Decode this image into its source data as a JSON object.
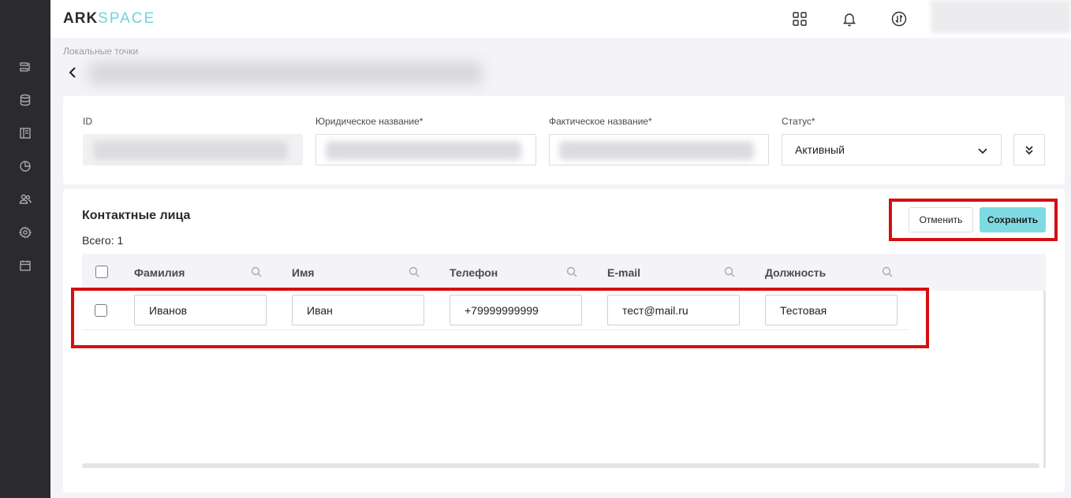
{
  "logo": {
    "part1": "ARK",
    "part2": "SPACE"
  },
  "sidebar": {
    "items": [
      {
        "name": "list-icon"
      },
      {
        "name": "database-icon"
      },
      {
        "name": "layout-icon"
      },
      {
        "name": "pie-chart-icon"
      },
      {
        "name": "users-icon"
      },
      {
        "name": "settings-icon"
      },
      {
        "name": "calendar-icon"
      }
    ]
  },
  "topbar": {
    "icons": [
      "grid-icon",
      "bell-icon",
      "sync-icon"
    ]
  },
  "breadcrumb": "Локальные точки",
  "form": {
    "id_label": "ID",
    "legal_name_label": "Юридическое название*",
    "actual_name_label": "Фактическое название*",
    "status_label": "Статус*",
    "status_value": "Активный"
  },
  "contacts": {
    "title": "Контактные лица",
    "total": "Всего: 1",
    "cancel_label": "Отменить",
    "save_label": "Сохранить",
    "columns": [
      "Фамилия",
      "Имя",
      "Телефон",
      "E-mail",
      "Должность"
    ],
    "rows": [
      {
        "last_name": "Иванов",
        "first_name": "Иван",
        "phone": "+79999999999",
        "email": "тест@mail.ru",
        "position": "Тестовая"
      }
    ]
  },
  "colors": {
    "accent": "#7fdbe3",
    "highlight": "#d50f0f",
    "sidebar_bg": "#2b2b2d"
  }
}
